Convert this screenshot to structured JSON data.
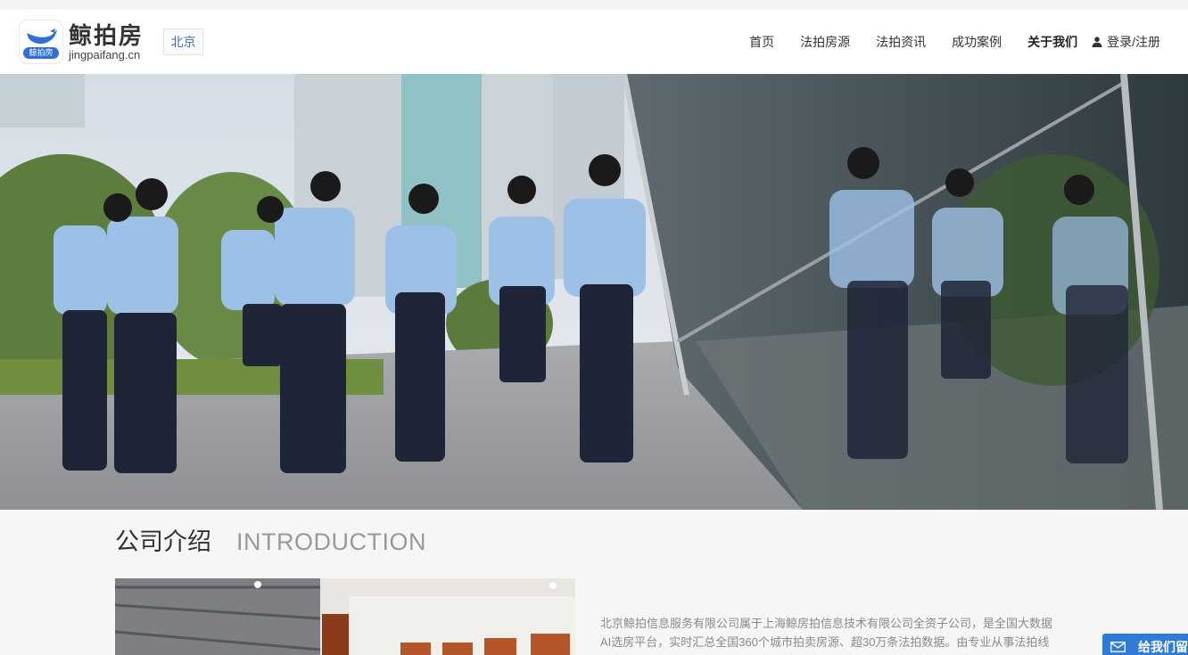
{
  "header": {
    "logo_cn": "鲸拍房",
    "logo_en": "jingpaifang.cn",
    "logo_tag": "鲸拍房",
    "city": "北京"
  },
  "nav": {
    "items": [
      {
        "label": "首页",
        "active": false
      },
      {
        "label": "法拍房源",
        "active": false
      },
      {
        "label": "法拍资讯",
        "active": false
      },
      {
        "label": "成功案例",
        "active": false
      },
      {
        "label": "关于我们",
        "active": true
      }
    ],
    "login_label": "登录/注册"
  },
  "section": {
    "title_cn": "公司介绍",
    "title_en": "INTRODUCTION"
  },
  "intro": {
    "text": "北京鲸拍信息服务有限公司属于上海鲸房拍信息技术有限公司全资子公司，是全国大数据AI选房平台，实时汇总全国360个城市拍卖房源、超30万条法拍数据。由专业从事法拍线下直投业务的资深团队，以及一批国内顶尖的技术开发专家团队联合打造。"
  },
  "float_button": {
    "label": "给我们留言"
  },
  "colors": {
    "accent": "#2f7bd8",
    "nav_text": "#333333",
    "city_text": "#4b6aa8",
    "intro_text": "#8a8a8a"
  }
}
